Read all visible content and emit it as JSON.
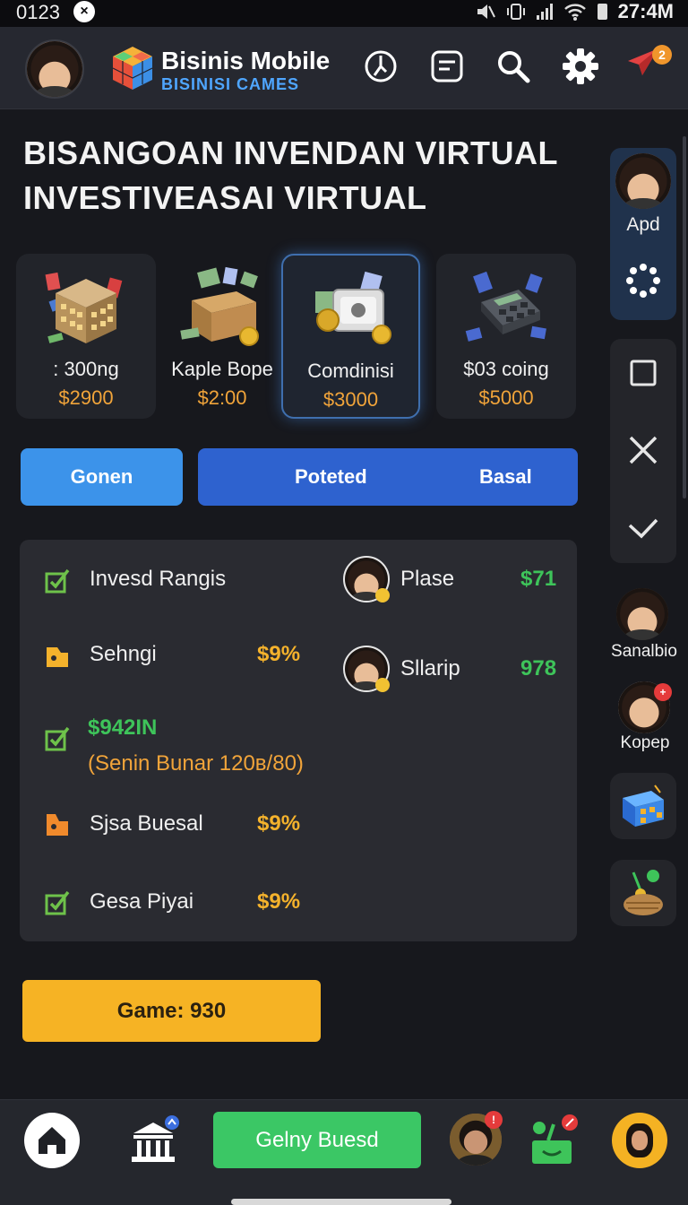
{
  "status_bar": {
    "left_text": "0123",
    "clock": "27:4M"
  },
  "header": {
    "app_name": "Bisinis Mobile",
    "app_subtitle": "BISINISI CAMES",
    "notification_count": "2"
  },
  "main": {
    "title_line1": "BISANGOAN INVENDAN VIRTUAL",
    "title_line2": "INVESTIVEASAI VIRTUAL"
  },
  "cards": [
    {
      "name": ": 300ng",
      "price": "$2900"
    },
    {
      "name": "Kaple Bope",
      "price": "$2:00"
    },
    {
      "name": "Comdinisi",
      "price": "$3000"
    },
    {
      "name": "$03 coing",
      "price": "$5000"
    }
  ],
  "tabs": {
    "gonen": "Gonen",
    "poteted": "Poteted",
    "basal": "Basal"
  },
  "panel": {
    "rows": [
      {
        "label": "Invesd Rangis"
      },
      {
        "label": "Sehngi",
        "value": "$9%"
      },
      {
        "label": "$942IN",
        "sublabel": "(Senin  Bunar 120в/80)"
      },
      {
        "label": "Sjsa Buesal",
        "value": "$9%"
      },
      {
        "label": "Gesa Piyai",
        "value": "$9%"
      }
    ],
    "players": [
      {
        "name": "Plase",
        "value": "$71"
      },
      {
        "name": "Sllarip",
        "value": "978"
      }
    ]
  },
  "game_button": "Game: 930",
  "sidebar": {
    "user_label": "Apd",
    "friend1": "Sanalbio",
    "friend2": "Kopep"
  },
  "bottom_bar": {
    "cta_label": "Gelny Buesd"
  },
  "colors": {
    "accent_blue": "#2e62cf",
    "light_blue": "#3c93ea",
    "gold": "#f6b324",
    "green": "#3bc765",
    "background": "#17181d"
  }
}
